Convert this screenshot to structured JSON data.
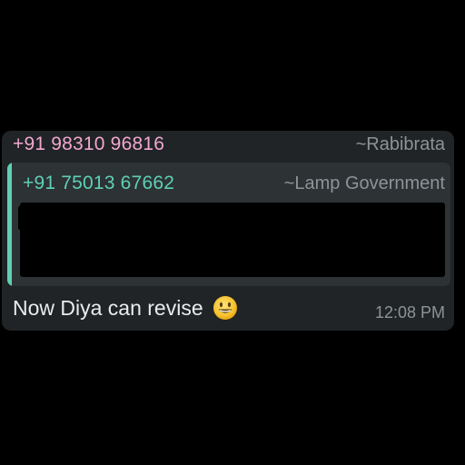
{
  "message": {
    "sender_phone": "+91 98310 96816",
    "sender_name": "~Rabibrata",
    "quoted": {
      "phone": "+91 75013 67662",
      "name": "~Lamp Government"
    },
    "text": "Now Diya can revise",
    "emoji_icon": "grinning-face-emoji",
    "timestamp": "12:08 PM"
  },
  "colors": {
    "background": "#000000",
    "bubble": "#202426",
    "quote_bg": "#2d3235",
    "sender_phone": "#f2a7cf",
    "quote_accent": "#5fd0b4",
    "muted_text": "#8d9396",
    "message_text": "#e9ecef"
  }
}
